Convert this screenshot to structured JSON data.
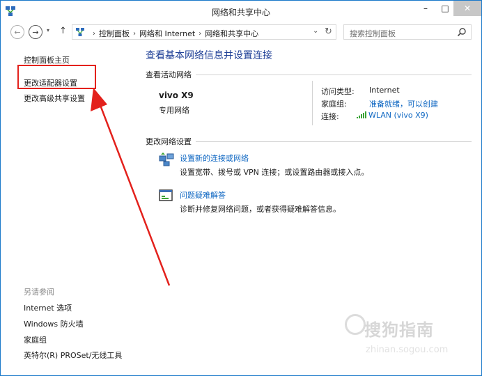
{
  "window": {
    "title": "网络和共享中心",
    "minimize_glyph": "–",
    "maximize_glyph": "□",
    "close_glyph": "✕"
  },
  "navigation": {
    "back_glyph": "←",
    "forward_glyph": "→",
    "history_glyph": "▾",
    "up_glyph": "↑",
    "breadcrumbs": [
      "控制面板",
      "网络和 Internet",
      "网络和共享中心"
    ],
    "breadcrumb_separator": "›",
    "dropdown_glyph": "⌄",
    "refresh_glyph": "↻"
  },
  "search": {
    "placeholder": "搜索控制面板"
  },
  "left_pane": {
    "links": [
      "控制面板主页",
      "更改适配器设置",
      "更改高级共享设置"
    ],
    "see_also_label": "另请参阅",
    "see_also_links": [
      "Internet 选项",
      "Windows 防火墙",
      "家庭组",
      "英特尔(R) PROSet/无线工具"
    ]
  },
  "main": {
    "heading": "查看基本网络信息并设置连接",
    "active_networks_label": "查看活动网络",
    "network": {
      "name": "vivo X9",
      "category": "专用网络",
      "access_type_label": "访问类型:",
      "access_type_value": "Internet",
      "homegroup_label": "家庭组:",
      "homegroup_value": "准备就绪，可以创建",
      "connection_label": "连接:",
      "connection_value": "WLAN (vivo X9)"
    },
    "change_settings_label": "更改网络设置",
    "tasks": [
      {
        "icon": "network-setup-icon",
        "title": "设置新的连接或网络",
        "description": "设置宽带、拨号或 VPN 连接；或设置路由器或接入点。"
      },
      {
        "icon": "troubleshoot-icon",
        "title": "问题疑难解答",
        "description": "诊断并修复网络问题，或者获得疑难解答信息。"
      }
    ]
  },
  "annotation": {
    "highlight_color": "#e3211c"
  },
  "watermark": {
    "text": "搜狗指南",
    "url": "zhinan.sogou.com"
  },
  "colors": {
    "link": "#0d66c2",
    "heading": "#1e3f96",
    "window_border": "#1979ca",
    "wifi_bars": "#3aa335"
  }
}
